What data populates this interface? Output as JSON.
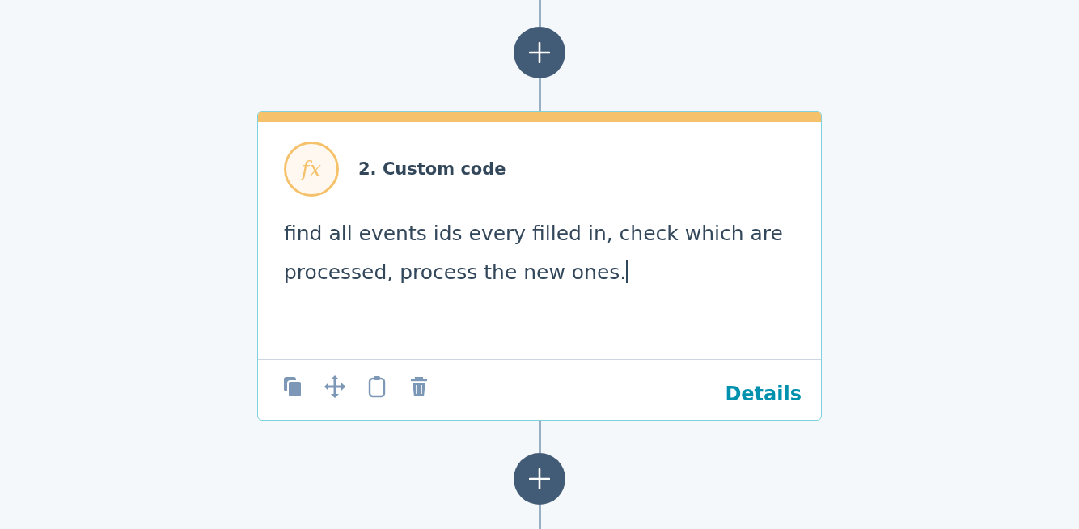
{
  "action_card": {
    "icon_text": "fx",
    "title": "2. Custom code",
    "description": "find all events ids every filled in, check which are processed, process the new ones.",
    "text_cursor": true,
    "toolbar": [
      {
        "kind": "copy"
      },
      {
        "kind": "move"
      },
      {
        "kind": "clipboard"
      },
      {
        "kind": "delete"
      }
    ],
    "details_link": "Details"
  }
}
